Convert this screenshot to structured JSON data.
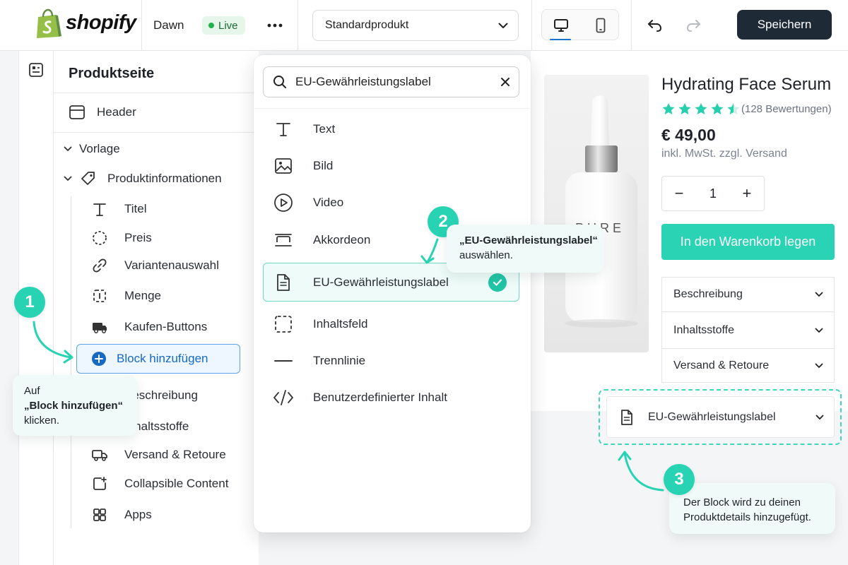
{
  "brand": {
    "name": "shopify"
  },
  "topbar": {
    "theme_name": "Dawn",
    "live_label": "Live",
    "template_select": "Standardprodukt",
    "save_label": "Speichern"
  },
  "sidebar": {
    "title": "Produktseite",
    "header_label": "Header",
    "template_label": "Vorlage",
    "section_label": "Produktinformationen",
    "blocks": [
      {
        "label": "Titel",
        "icon": "title-icon"
      },
      {
        "label": "Preis",
        "icon": "price-icon"
      },
      {
        "label": "Variantenauswahl",
        "icon": "link-icon"
      },
      {
        "label": "Menge",
        "icon": "quantity-icon"
      },
      {
        "label": "Kaufen-Buttons",
        "icon": "buy-buttons-icon"
      }
    ],
    "add_block_label": "Block hinzufügen",
    "more_blocks": [
      {
        "label": "Beschreibung",
        "icon": "description-icon"
      },
      {
        "label": "Inhaltsstoffe",
        "icon": "ingredients-icon"
      },
      {
        "label": "Versand & Retoure",
        "icon": "truck-icon"
      },
      {
        "label": "Collapsible Content",
        "icon": "collapsible-icon"
      },
      {
        "label": "Apps",
        "icon": "apps-icon"
      }
    ]
  },
  "picker": {
    "search_value": "EU-Gewährleistungslabel",
    "items": [
      {
        "label": "Text",
        "icon": "text-icon"
      },
      {
        "label": "Bild",
        "icon": "image-icon"
      },
      {
        "label": "Video",
        "icon": "video-icon"
      },
      {
        "label": "Akkordeon",
        "icon": "accordion-icon"
      },
      {
        "label": "EU-Gewährleistungslabel",
        "icon": "document-icon",
        "selected": true
      },
      {
        "label": "Inhaltsfeld",
        "icon": "content-field-icon"
      },
      {
        "label": "Trennlinie",
        "icon": "divider-icon"
      },
      {
        "label": "Benutzerdefinierter Inhalt",
        "icon": "code-icon"
      }
    ]
  },
  "product": {
    "image_brand_text": "PURE",
    "title": "Hydrating Face Serum",
    "rating": 4.5,
    "reviews": "(128 Bewertungen)",
    "price": "€ 49,00",
    "tax_note": "inkl. MwSt. zzgl. Versand",
    "quantity": "1",
    "qty_minus": "−",
    "qty_plus": "+",
    "cart_label": "In den Warenkorb legen",
    "accordions": [
      "Beschreibung",
      "Inhaltsstoffe",
      "Versand & Retoure"
    ],
    "new_block_label": "EU-Gewährleistungslabel"
  },
  "tutorial": {
    "step1": {
      "number": "1",
      "line1": "Auf",
      "line2": "„Block hinzufügen“",
      "line3": "klicken."
    },
    "step2": {
      "number": "2",
      "line1": "„EU-Gewährleistungslabel“",
      "line2": "auswählen."
    },
    "step3": {
      "number": "3",
      "line1": "Der Block wird zu deinen",
      "line2": "Produktdetails hinzugefügt."
    }
  },
  "colors": {
    "accent_teal": "#27d3b3",
    "save_button": "#1f2a37",
    "highlight_blue": "#1669c4",
    "live_green": "#22b24c"
  }
}
